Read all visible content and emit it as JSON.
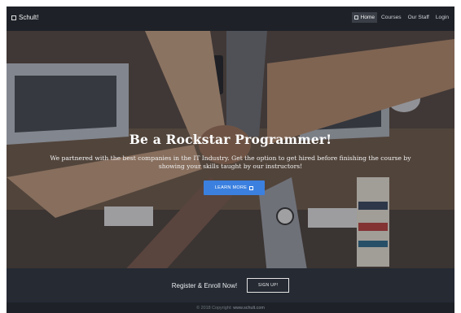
{
  "brand": {
    "icon": "square-icon",
    "name": "Schult!"
  },
  "nav": {
    "items": [
      {
        "label": "Home",
        "icon": "square-icon",
        "active": true
      },
      {
        "label": "Courses",
        "active": false
      },
      {
        "label": "Our Staff",
        "active": false
      },
      {
        "label": "Login",
        "active": false
      }
    ]
  },
  "hero": {
    "title": "Be a Rockstar Programmer!",
    "subtitle": "We partnered with the best companies in the IT Industry. Get the option to get hired before finishing the course by showing your skills taught by our instructors!",
    "button_label": "LEARN MORE",
    "button_icon": "square-icon",
    "button_color": "#3b80df"
  },
  "cta": {
    "text": "Register & Enroll Now!",
    "button_label": "SIGN UP!"
  },
  "footer": {
    "copyright": "© 2018 Copyright:",
    "link": "www.schult.com"
  }
}
